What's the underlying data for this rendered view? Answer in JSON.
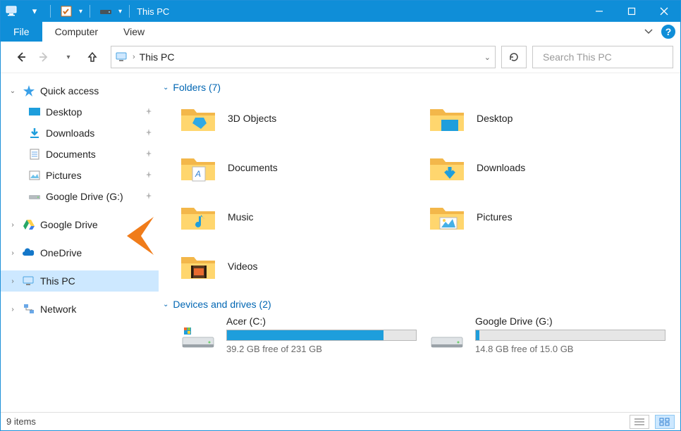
{
  "window": {
    "title": "This PC"
  },
  "ribbon": {
    "file": "File",
    "tabs": [
      "Computer",
      "View"
    ]
  },
  "nav": {
    "address": "This PC",
    "search_placeholder": "Search This PC"
  },
  "sidebar": {
    "quick_access": "Quick access",
    "quick_items": [
      {
        "label": "Desktop"
      },
      {
        "label": "Downloads"
      },
      {
        "label": "Documents"
      },
      {
        "label": "Pictures"
      },
      {
        "label": "Google Drive (G:)"
      }
    ],
    "roots": [
      {
        "label": "Google Drive"
      },
      {
        "label": "OneDrive"
      },
      {
        "label": "This PC",
        "selected": true
      },
      {
        "label": "Network"
      }
    ]
  },
  "sections": {
    "folders_header": "Folders (7)",
    "drives_header": "Devices and drives (2)"
  },
  "folders": [
    {
      "label": "3D Objects"
    },
    {
      "label": "Desktop"
    },
    {
      "label": "Documents"
    },
    {
      "label": "Downloads"
    },
    {
      "label": "Music"
    },
    {
      "label": "Pictures"
    },
    {
      "label": "Videos"
    }
  ],
  "drives": [
    {
      "name": "Acer (C:)",
      "free": "39.2 GB free of 231 GB",
      "fill_pct": 83
    },
    {
      "name": "Google Drive (G:)",
      "free": "14.8 GB free of 15.0 GB",
      "fill_pct": 2
    }
  ],
  "status": {
    "items": "9 items"
  }
}
